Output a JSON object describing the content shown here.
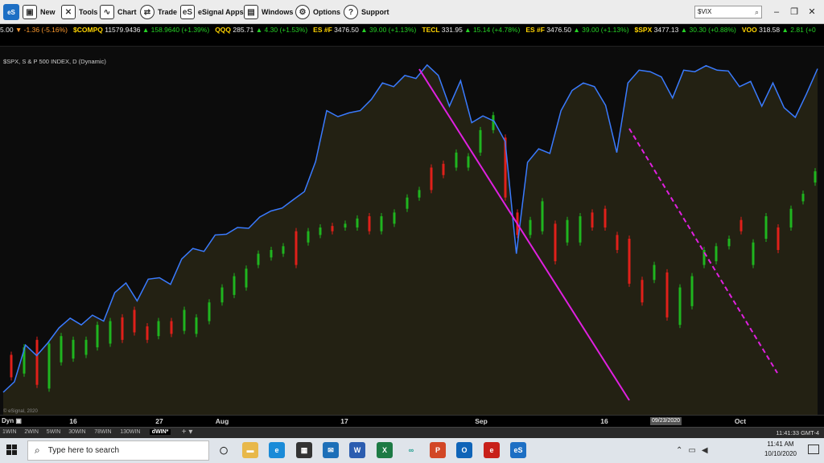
{
  "toolbar": {
    "logo": "eS",
    "buttons": [
      {
        "id": "new",
        "label": "New",
        "icon": "new-window-icon",
        "glyph": "▣"
      },
      {
        "id": "tools",
        "label": "Tools",
        "icon": "tools-icon",
        "glyph": "✕"
      },
      {
        "id": "chart",
        "label": "Chart",
        "icon": "chart-icon",
        "glyph": "∿"
      },
      {
        "id": "trade",
        "label": "Trade",
        "icon": "trade-icon",
        "glyph": "⇄"
      },
      {
        "id": "esignal-apps",
        "label": "eSignal Apps",
        "icon": "apps-icon",
        "glyph": "eS"
      },
      {
        "id": "windows",
        "label": "Windows",
        "icon": "windows-icon",
        "glyph": "▤"
      },
      {
        "id": "options",
        "label": "Options",
        "icon": "gear-icon",
        "glyph": "⚙"
      },
      {
        "id": "support",
        "label": "Support",
        "icon": "help-icon",
        "glyph": "?"
      }
    ],
    "search_value": "$VIX"
  },
  "ticker": [
    {
      "sym": "",
      "last": "5.00",
      "chg": "▼ -1.36 (-5.16%)",
      "dir": "dn"
    },
    {
      "sym": "$COMPQ",
      "last": "11579.9436",
      "chg": "▲ 158.9640 (+1.39%)",
      "dir": "up"
    },
    {
      "sym": "QQQ",
      "last": "285.71",
      "chg": "▲ 4.30 (+1.53%)",
      "dir": "up"
    },
    {
      "sym": "ES #F",
      "last": "3476.50",
      "chg": "▲ 39.00 (+1.13%)",
      "dir": "up"
    },
    {
      "sym": "TECL",
      "last": "331.95",
      "chg": "▲ 15.14 (+4.78%)",
      "dir": "up"
    },
    {
      "sym": "ES #F",
      "last": "3476.50",
      "chg": "▲ 39.00 (+1.13%)",
      "dir": "up"
    },
    {
      "sym": "$SPX",
      "last": "3477.13",
      "chg": "▲ 30.30 (+0.88%)",
      "dir": "up"
    },
    {
      "sym": "VOO",
      "last": "318.58",
      "chg": "▲ 2.81 (+0",
      "dir": "up"
    }
  ],
  "chart": {
    "label": "$SPX, S & P 500 INDEX, D (Dynamic)",
    "watermark": "© eSignal, 2020",
    "x_ticks": [
      "16",
      "27",
      "Aug",
      "17",
      "Sep",
      "16",
      "Oct"
    ],
    "dyn_label": "Dyn",
    "crosshair_date": "09/23/2020",
    "colors": {
      "line": "#3a7bff",
      "fill": "#262414",
      "trend": "#e020e0",
      "up": "#1fb51f",
      "down": "#e0201a",
      "bg": "#0c0c0c"
    }
  },
  "chart_data": {
    "type": "line",
    "series": [
      {
        "values": [
          30,
          44,
          93,
          79,
          96,
          116,
          129,
          120,
          133,
          125,
          163,
          176,
          152,
          181,
          183,
          174,
          208,
          222,
          218,
          240,
          241,
          250,
          249,
          264,
          272,
          276,
          287,
          298,
          338,
          406,
          398,
          403,
          406,
          421,
          443,
          438,
          453,
          449,
          467,
          453,
          412,
          446,
          390,
          399,
          392,
          365,
          215,
          337,
          355,
          349,
          406,
          433,
          443,
          438,
          413,
          350,
          443,
          460,
          458,
          451,
          423,
          460,
          458,
          466,
          460,
          459,
          438,
          445,
          412,
          443,
          410,
          397,
          428,
          462
        ]
      }
    ]
  },
  "intervals": [
    "1WIN",
    "2WIN",
    "5WIN",
    "30WIN",
    "78WIN",
    "130WIN",
    "dWIN*"
  ],
  "status_time": "11:41:33 GMT-4",
  "taskbar": {
    "search_placeholder": "Type here to search",
    "time": "11:41 AM",
    "date": "10/10/2020",
    "apps": [
      {
        "name": "task-view-icon",
        "glyph": "◯",
        "bg": "transparent",
        "fg": "#222"
      },
      {
        "name": "file-explorer-icon",
        "glyph": "▬",
        "bg": "#e8b84a",
        "fg": "#fff"
      },
      {
        "name": "edge-icon",
        "glyph": "e",
        "bg": "#1a8bd8",
        "fg": "#fff"
      },
      {
        "name": "store-icon",
        "glyph": "▦",
        "bg": "#333",
        "fg": "#fff"
      },
      {
        "name": "mail-icon",
        "glyph": "✉",
        "bg": "#1c6fb8",
        "fg": "#fff"
      },
      {
        "name": "word-icon",
        "glyph": "W",
        "bg": "#2b5db0",
        "fg": "#fff"
      },
      {
        "name": "excel-icon",
        "glyph": "X",
        "bg": "#1d7a44",
        "fg": "#fff"
      },
      {
        "name": "link-icon",
        "glyph": "∞",
        "bg": "transparent",
        "fg": "#1a9c8c"
      },
      {
        "name": "powerpoint-icon",
        "glyph": "P",
        "bg": "#d24726",
        "fg": "#fff"
      },
      {
        "name": "outlook-icon",
        "glyph": "O",
        "bg": "#0f64b8",
        "fg": "#fff"
      },
      {
        "name": "app-red-icon",
        "glyph": "e",
        "bg": "#c8201a",
        "fg": "#fff"
      },
      {
        "name": "esignal-task-icon",
        "glyph": "eS",
        "bg": "#1d6fc4",
        "fg": "#fff"
      }
    ]
  }
}
